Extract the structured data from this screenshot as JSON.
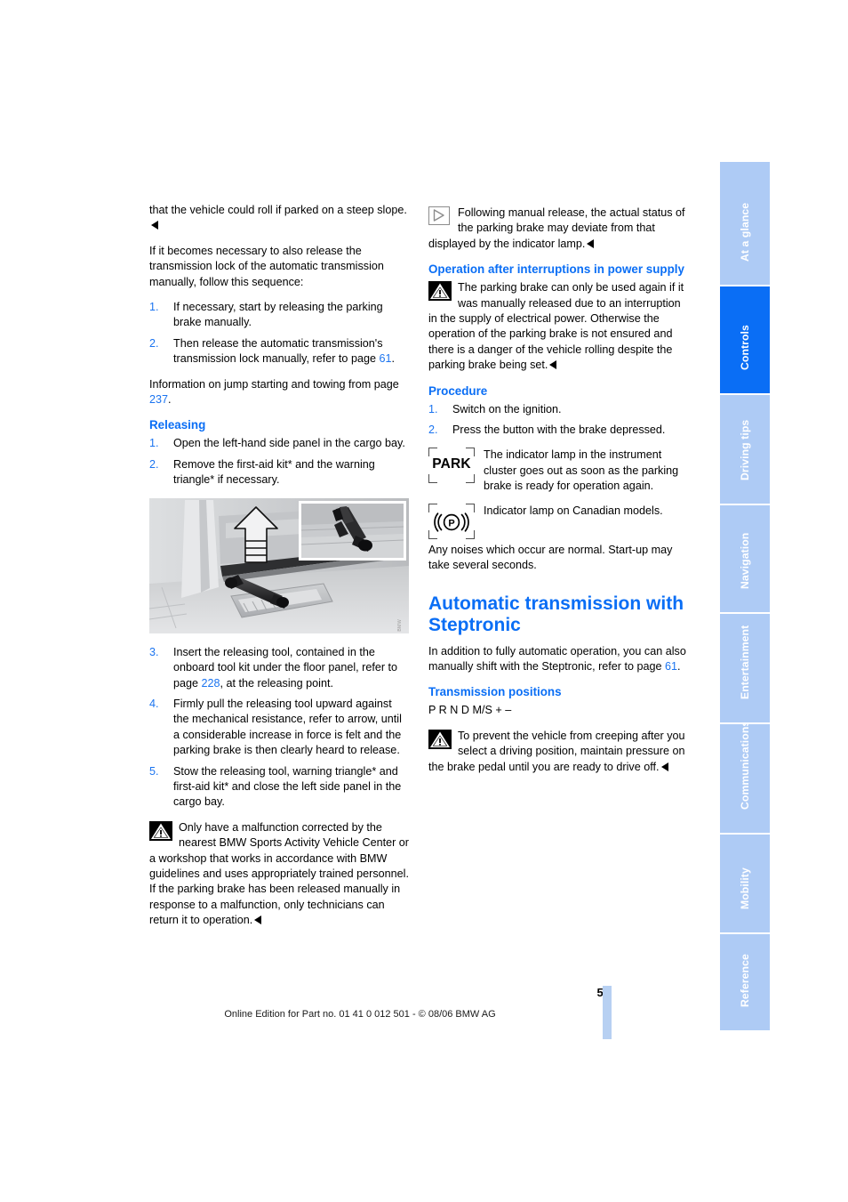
{
  "document": {
    "page_number": "59",
    "edition_line": "Online Edition for Part no. 01 41 0 012 501 - © 08/06 BMW AG",
    "accent_color": "#0a6ef5",
    "tab_inactive_color": "#aecbf5"
  },
  "tabs": [
    {
      "label": "At a glance",
      "active": false
    },
    {
      "label": "Controls",
      "active": true
    },
    {
      "label": "Driving tips",
      "active": false
    },
    {
      "label": "Navigation",
      "active": false
    },
    {
      "label": "Entertainment",
      "active": false
    },
    {
      "label": "Communications",
      "active": false
    },
    {
      "label": "Mobility",
      "active": false
    },
    {
      "label": "Reference",
      "active": false
    }
  ],
  "left_column": {
    "intro_continued": "that the vehicle could roll if parked on a steep slope.",
    "lock_intro": "If it becomes necessary to also release the transmission lock of the automatic transmission manually, follow this sequence:",
    "lock_steps": [
      {
        "num": "1.",
        "text": "If necessary, start by releasing the parking brake manually."
      },
      {
        "num": "2.",
        "text_before": "Then release the automatic transmission's transmission lock manually, refer to page ",
        "page_ref": "61",
        "text_after": "."
      }
    ],
    "jump_start_note_before": "Information on jump starting and towing from page ",
    "jump_start_page_ref": "237",
    "jump_start_note_after": ".",
    "releasing_heading": "Releasing",
    "releasing_steps_a": [
      {
        "num": "1.",
        "text": "Open the left-hand side panel in the cargo bay."
      },
      {
        "num": "2.",
        "text": "Remove the first-aid kit* and the warning triangle* if necessary."
      }
    ],
    "illustration": {
      "description": "Cargo bay left-hand side panel with releasing tool and arrow showing upward pull, inset detail of tool",
      "credit": "BMW"
    },
    "releasing_steps_b": [
      {
        "num": "3.",
        "text_before": "Insert the releasing tool, contained in the onboard tool kit under the floor panel, refer to page ",
        "page_ref": "228",
        "text_after": ", at the releasing point."
      },
      {
        "num": "4.",
        "text": "Firmly pull the releasing tool upward against the mechanical resistance, refer to arrow, until a considerable increase in force is felt and the parking brake is then clearly heard to release."
      },
      {
        "num": "5.",
        "text": "Stow the releasing tool, warning triangle* and first-aid kit* and close the left side panel in the cargo bay."
      }
    ],
    "warning_malfunction": "Only have a malfunction corrected by the nearest BMW Sports Activity Vehicle Center or a workshop that works in accordance with BMW guidelines and uses appropriately trained personnel. If the parking brake has been released manually in response to a malfunction, only technicians can return it to operation."
  },
  "right_column": {
    "note_manual_release": "Following manual release, the actual status of the parking brake may deviate from that displayed by the indicator lamp.",
    "power_supply_heading": "Operation after interruptions in power supply",
    "warning_power_supply": "The parking brake can only be used again if it was manually released due to an interruption in the supply of electrical power. Otherwise the operation of the parking brake is not ensured and there is a danger of the vehicle rolling despite the parking brake being set.",
    "procedure_heading": "Procedure",
    "procedure_steps": [
      {
        "num": "1.",
        "text": "Switch on the ignition."
      },
      {
        "num": "2.",
        "text": "Press the button with the brake depressed."
      }
    ],
    "lamp_park_label": "PARK",
    "lamp_park_text": "The indicator lamp in the instrument cluster goes out as soon as the parking brake is ready for operation again.",
    "lamp_canadian_text": "Indicator lamp on Canadian models.",
    "noises_text": "Any noises which occur are normal. Start-up may take several seconds.",
    "steptronic_heading": "Automatic transmission with Steptronic",
    "steptronic_intro_before": "In addition to fully automatic operation, you can also manually shift with the Steptronic, refer to page ",
    "steptronic_page_ref": "61",
    "steptronic_intro_after": ".",
    "transmission_positions_heading": "Transmission positions",
    "transmission_positions_list": "P R N D M/S + –",
    "warning_creeping": "To prevent the vehicle from creeping after you select a driving position, maintain pressure on the brake pedal until you are ready to drive off."
  }
}
